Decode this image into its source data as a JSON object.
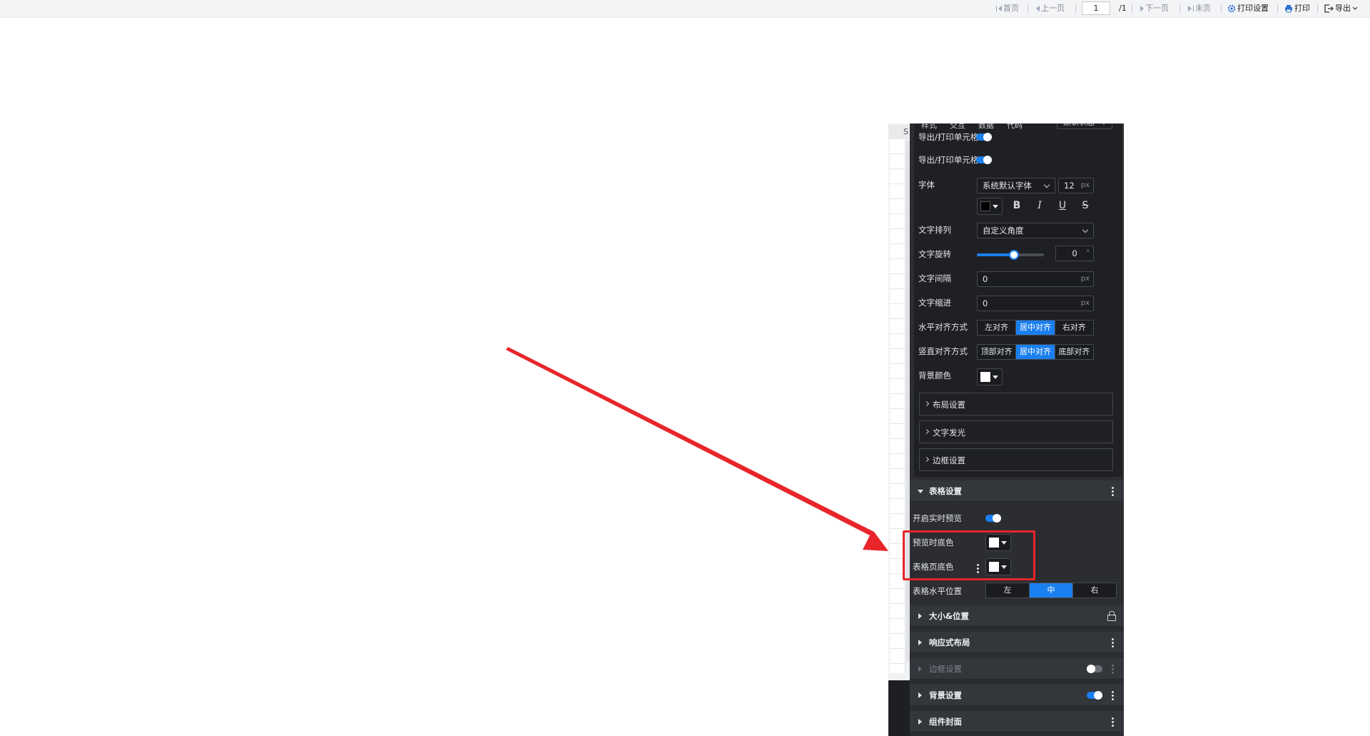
{
  "toolbar": {
    "first": "首页",
    "prev": "上一页",
    "page_value": "1",
    "page_total": "/1",
    "next": "下一页",
    "last": "末页",
    "print_settings": "打印设置",
    "print": "打印",
    "export": "导出"
  },
  "editor": {
    "sheet_header": "S",
    "tabs": [
      "样式",
      "交互",
      "数据",
      "代码"
    ],
    "state": "默认状态",
    "export_row_1": "导出/打印单元格...",
    "export_row_2": "导出/打印单元格...",
    "font_label": "字体",
    "font_family": "系统默认字体",
    "font_size": "12",
    "unit_px": "px",
    "font_color": "#000000",
    "format_buttons": [
      "B",
      "I",
      "U",
      "S"
    ],
    "text_arrange_label": "文字排列",
    "text_arrange_value": "自定义角度",
    "rotate_label": "文字旋转",
    "rotate_value": "0",
    "rotate_unit": "°",
    "rotate_fraction": 0.55,
    "spacing_label": "文字间隔",
    "spacing_value": "0",
    "indent_label": "文字缩进",
    "indent_value": "0",
    "h_align_label": "水平对齐方式",
    "h_align_options": [
      "左对齐",
      "居中对齐",
      "右对齐"
    ],
    "h_align_selected": "居中对齐",
    "v_align_label": "竖直对齐方式",
    "v_align_options": [
      "顶部对齐",
      "居中对齐",
      "底部对齐"
    ],
    "v_align_selected": "居中对齐",
    "bg_color_label": "背景颜色",
    "bg_color": "#ffffff",
    "collapsibles": [
      "布局设置",
      "文字发光",
      "边框设置"
    ],
    "table_section": "表格设置",
    "live_preview_label": "开启实时预览",
    "preview_bg_label": "预览时底色",
    "preview_bg_color": "#ffffff",
    "page_bg_label": "表格页底色",
    "page_bg_color": "#ffffff",
    "table_hpos_label": "表格水平位置",
    "table_hpos_options": [
      "左",
      "中",
      "右"
    ],
    "table_hpos_selected": "中",
    "sections": [
      "大小&位置",
      "响应式布局",
      "边框设置",
      "背景设置",
      "组件封面"
    ]
  },
  "colors": {
    "accent": "#1a7ff0",
    "annotation": "#e8262a",
    "panel_bg": "#2b2d31"
  }
}
